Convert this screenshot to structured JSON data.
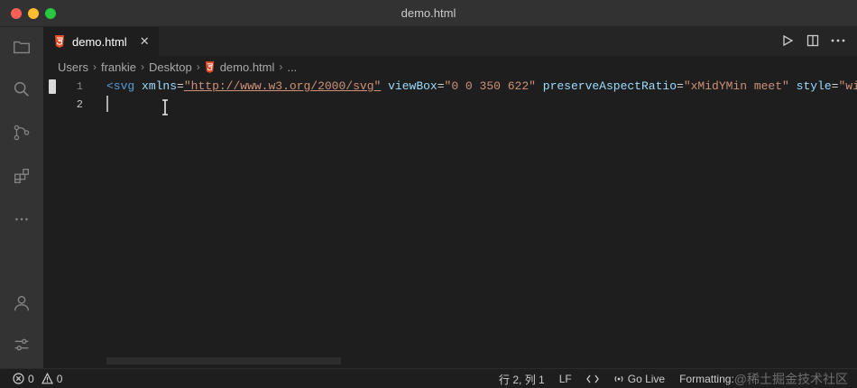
{
  "window": {
    "title": "demo.html"
  },
  "colors": {
    "html_icon": "#e44d26",
    "traffic_red": "#ff5f57",
    "traffic_yellow": "#febc2e",
    "traffic_green": "#28c840"
  },
  "activity_bar": {
    "icons": [
      "files-icon",
      "search-icon",
      "source-control-icon",
      "extensions-icon",
      "more-icon",
      "account-icon",
      "settings-icon"
    ]
  },
  "tab": {
    "label": "demo.html",
    "close": "✕",
    "icon": "html5-icon"
  },
  "editor_actions": [
    "run-icon",
    "split-editor-icon",
    "more-actions-icon"
  ],
  "breadcrumb": {
    "items": [
      "Users",
      "frankie",
      "Desktop",
      "demo.html",
      "..."
    ],
    "separator": "›"
  },
  "editor": {
    "line_numbers": [
      "1",
      "2"
    ],
    "line1": {
      "open": "<svg",
      "a1": "xmlns",
      "v1": "\"http://www.w3.org/2000/svg\"",
      "a2": "viewBox",
      "v2": "\"0 0 350 622\"",
      "a3": "preserveAspectRatio",
      "v3": "\"xMidYMin meet\"",
      "a4": "style",
      "v4": "\"wi"
    },
    "eq": "="
  },
  "status": {
    "errors": "0",
    "warnings": "0",
    "position": "行 2, 列 1",
    "eol": "LF",
    "go_live": "Go Live",
    "formatting": "Formatting:",
    "watermark": "@稀土掘金技术社区"
  }
}
